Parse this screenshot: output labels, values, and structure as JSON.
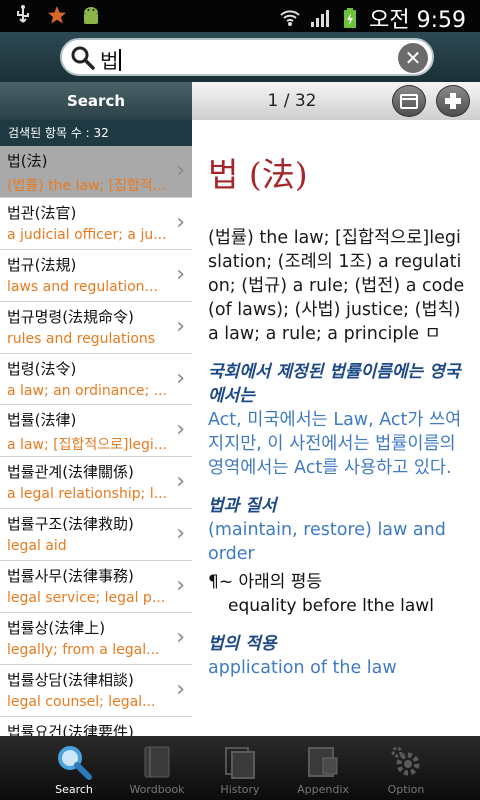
{
  "status": {
    "time": "오전 9:59",
    "icons": [
      "usb-icon",
      "star-icon",
      "android-icon",
      "wifi-icon",
      "signal-icon",
      "battery-icon"
    ]
  },
  "search": {
    "value": "법"
  },
  "left_header": "Search",
  "page_indicator": "1 / 32",
  "result_count": "검색된 항목 수 : 32",
  "list": [
    {
      "head": "법(法)",
      "sub": "(법률) the law; [집합적..."
    },
    {
      "head": "법관(法官)",
      "sub": "a judicial officer; a ju..."
    },
    {
      "head": "법규(法規)",
      "sub": "laws and regulation..."
    },
    {
      "head": "법규명령(法規命令)",
      "sub": "rules and regulations"
    },
    {
      "head": "법령(法令)",
      "sub": "a law; an ordinance; ..."
    },
    {
      "head": "법률(法律)",
      "sub": "a law; [집합적으로]legi..."
    },
    {
      "head": "법률관계(法律關係)",
      "sub": "a legal relationship; l..."
    },
    {
      "head": "법률구조(法律救助)",
      "sub": "legal aid"
    },
    {
      "head": "법률사무(法律事務)",
      "sub": "legal service; legal p..."
    },
    {
      "head": "법률상(法律上)",
      "sub": "legally; from a legal..."
    },
    {
      "head": "법률상담(法律相談)",
      "sub": "legal counsel; legal..."
    },
    {
      "head": "법률요건(法律要件)",
      "sub": ""
    }
  ],
  "entry": {
    "title": "법 (法)",
    "definition": "(법률) the law; [집합적으로]legislation; (조례의 1조) a regulation; (법규) a rule; (법전) a code (of laws); (사법) justice; (법칙) a law; a rule; a principle ㅁ",
    "sections": [
      {
        "heading": "국회에서 제정된 법률이름에는 영국에서는",
        "body": "Act, 미국에서는 Law, Act가 쓰여지지만, 이 사전에서는 법률이름의 영역에서는 Act를 사용하고 있다."
      },
      {
        "heading": "법과 질서",
        "body": "(maintain, restore) law and order"
      }
    ],
    "example_ko": "¶~ 아래의 평등",
    "example_en": "equality before lthe lawl",
    "section3_heading": "법의 적용",
    "section3_body": "application of the law"
  },
  "tabs": [
    {
      "label": "Search",
      "icon": "search-icon",
      "active": true
    },
    {
      "label": "Wordbook",
      "icon": "book-icon",
      "active": false
    },
    {
      "label": "History",
      "icon": "history-icon",
      "active": false
    },
    {
      "label": "Appendix",
      "icon": "appendix-icon",
      "active": false
    },
    {
      "label": "Option",
      "icon": "gear-icon",
      "active": false
    }
  ],
  "colors": {
    "accent_orange": "#e87a1f",
    "title_red": "#a6272b",
    "link_blue": "#3f7bc4",
    "heading_navy": "#1d4a86",
    "header_teal": "#2b3f46"
  }
}
